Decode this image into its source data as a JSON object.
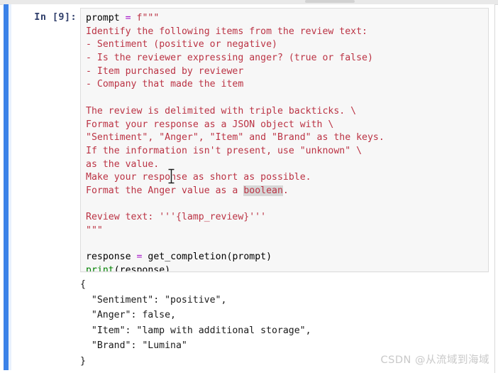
{
  "window": {
    "kind": "jupyter-notebook-cell"
  },
  "cell": {
    "in_prompt": "In [9]:",
    "execution_count": 9,
    "code_lines": [
      [
        {
          "t": "prompt",
          "c": "name"
        },
        {
          "t": " ",
          "c": "plain"
        },
        {
          "t": "=",
          "c": "op"
        },
        {
          "t": " ",
          "c": "plain"
        },
        {
          "t": "f\"\"\"",
          "c": "string"
        }
      ],
      [
        {
          "t": "Identify the following items from the review text:",
          "c": "string"
        }
      ],
      [
        {
          "t": "- Sentiment (positive or negative)",
          "c": "string"
        }
      ],
      [
        {
          "t": "- Is the reviewer expressing anger? (true or false)",
          "c": "string"
        }
      ],
      [
        {
          "t": "- Item purchased by reviewer",
          "c": "string"
        }
      ],
      [
        {
          "t": "- Company that made the item",
          "c": "string"
        }
      ],
      [
        {
          "t": "",
          "c": "plain"
        }
      ],
      [
        {
          "t": "The review is delimited with triple backticks. \\",
          "c": "string"
        }
      ],
      [
        {
          "t": "Format your response as a JSON object with \\",
          "c": "string"
        }
      ],
      [
        {
          "t": "\"Sentiment\", \"Anger\", \"Item\" and \"Brand\" as the keys.",
          "c": "string"
        }
      ],
      [
        {
          "t": "If the information isn't present, use \"unknown\" \\",
          "c": "string"
        }
      ],
      [
        {
          "t": "as the value.",
          "c": "string"
        }
      ],
      [
        {
          "t": "Make your response as short as possible.",
          "c": "string"
        }
      ],
      [
        {
          "t": "Format the Anger value as a ",
          "c": "string"
        },
        {
          "t": "boolean",
          "c": "string",
          "sel": true
        },
        {
          "t": ".",
          "c": "string"
        }
      ],
      [
        {
          "t": "",
          "c": "plain"
        }
      ],
      [
        {
          "t": "Review text: '''{lamp_review}'''",
          "c": "string"
        }
      ],
      [
        {
          "t": "\"\"\"",
          "c": "string"
        }
      ],
      [
        {
          "t": "",
          "c": "plain"
        }
      ],
      [
        {
          "t": "response",
          "c": "name"
        },
        {
          "t": " ",
          "c": "plain"
        },
        {
          "t": "=",
          "c": "op"
        },
        {
          "t": " ",
          "c": "plain"
        },
        {
          "t": "get_completion(prompt)",
          "c": "name"
        }
      ],
      [
        {
          "t": "print",
          "c": "builtin"
        },
        {
          "t": "(response)",
          "c": "name"
        }
      ]
    ]
  },
  "output": {
    "lines": [
      "{",
      "  \"Sentiment\": \"positive\",",
      "  \"Anger\": false,",
      "  \"Item\": \"lamp with additional storage\",",
      "  \"Brand\": \"Lumina\"",
      "}"
    ],
    "parsed": {
      "Sentiment": "positive",
      "Anger": "false",
      "Item": "lamp with additional storage",
      "Brand": "Lumina"
    }
  },
  "watermark": {
    "text": "CSDN @从流域到海域"
  },
  "colors": {
    "selected_cell_bar": "#3b82e8",
    "code_cell_bg": "#f7f7f7",
    "code_cell_border": "#dddddd",
    "string_token": "#bb3344",
    "operator_token": "#a718c9",
    "builtin_token": "#008000",
    "prompt_text": "#303f6b",
    "selection_highlight": "#d6d6d6",
    "watermark": "#c9c9c9"
  }
}
